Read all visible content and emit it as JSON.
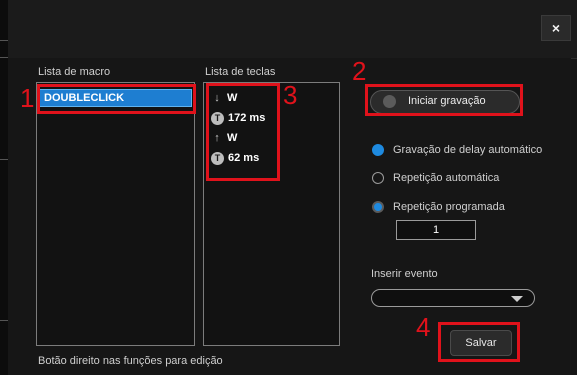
{
  "window": {
    "close_label": "×"
  },
  "macro_list": {
    "label": "Lista de macro",
    "items": [
      "DOUBLECLICK"
    ],
    "annotation": "1"
  },
  "key_list": {
    "label": "Lista de teclas",
    "annotation": "3",
    "events": [
      {
        "icon": "arrow-down-icon",
        "text": "W"
      },
      {
        "icon": "timer-icon",
        "text": "172 ms"
      },
      {
        "icon": "arrow-up-icon",
        "text": "W"
      },
      {
        "icon": "timer-icon",
        "text": "62 ms"
      }
    ]
  },
  "record": {
    "label": "Iniciar gravação",
    "annotation": "2"
  },
  "options": {
    "auto_delay": "Gravação de delay automático",
    "auto_repeat": "Repetição automática",
    "programmed_repeat": "Repetição programada",
    "repeat_count": "1"
  },
  "insert_event": {
    "label": "Inserir evento",
    "value": ""
  },
  "save": {
    "label": "Salvar",
    "annotation": "4"
  },
  "footer": {
    "hint": "Botão direito nas funções para edição"
  },
  "colors": {
    "accent": "#1e7ed1",
    "highlight": "#e0121b"
  }
}
